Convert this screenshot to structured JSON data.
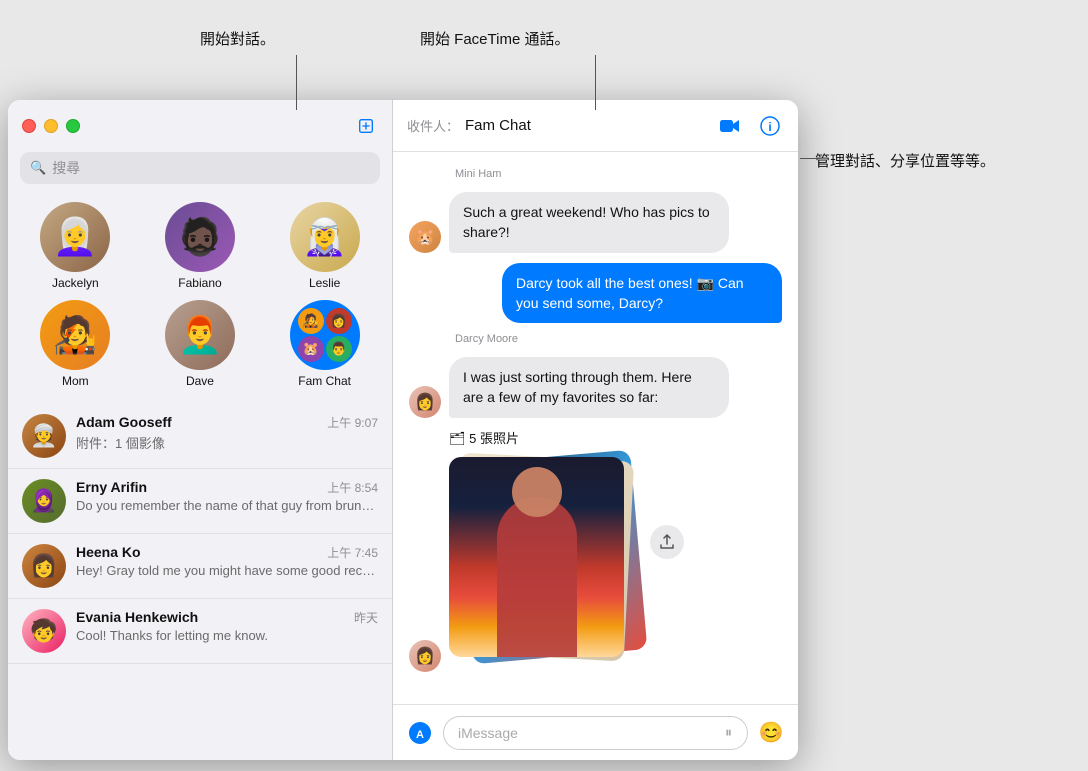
{
  "annotations": {
    "start_chat": "開始對話。",
    "start_facetime": "開始 FaceTime 通話。",
    "manage_chat": "管理對話、分享位置等等。"
  },
  "sidebar": {
    "search_placeholder": "搜尋",
    "compose_icon": "✏",
    "pinned": [
      {
        "id": "jackelyn",
        "name": "Jackelyn",
        "emoji": "👩‍🦳"
      },
      {
        "id": "fabiano",
        "name": "Fabiano",
        "emoji": "🧑‍🦱"
      },
      {
        "id": "leslie",
        "name": "Leslie",
        "emoji": "🧝"
      },
      {
        "id": "mom",
        "name": "Mom",
        "emoji": "🧑‍🎤"
      },
      {
        "id": "dave",
        "name": "Dave",
        "emoji": "👨"
      },
      {
        "id": "famchat",
        "name": "Fam Chat",
        "emoji": "group",
        "selected": true
      }
    ],
    "conversations": [
      {
        "id": "adam",
        "name": "Adam Gooseff",
        "time": "上午 9:07",
        "preview": "附件：1 個影像",
        "emoji": "👳"
      },
      {
        "id": "erny",
        "name": "Erny Arifin",
        "time": "上午 8:54",
        "preview": "Do you remember the name of that guy from brunch?",
        "emoji": "🧕"
      },
      {
        "id": "heena",
        "name": "Heena Ko",
        "time": "上午 7:45",
        "preview": "Hey! Gray told me you might have some good recommendations for our...",
        "emoji": "👩"
      },
      {
        "id": "evania",
        "name": "Evania Henkewich",
        "time": "昨天",
        "preview": "Cool! Thanks for letting me know.",
        "emoji": "🧒"
      }
    ]
  },
  "chat": {
    "to_label": "收件人：",
    "recipient": "Fam Chat",
    "facetime_icon": "📹",
    "info_icon": "ⓘ",
    "messages": [
      {
        "id": "msg1",
        "sender": "Mini Ham",
        "direction": "incoming",
        "text": "Such a great weekend! Who has pics to share?!",
        "avatar_emoji": "🐹"
      },
      {
        "id": "msg2",
        "sender": "me",
        "direction": "outgoing",
        "text": "Darcy took all the best ones! 📷 Can you send some, Darcy?"
      },
      {
        "id": "msg3",
        "sender": "Darcy Moore",
        "direction": "incoming",
        "text": "I was just sorting through them. Here are a few of my favorites so far:",
        "avatar_emoji": "👩"
      },
      {
        "id": "msg4",
        "sender": "Darcy Moore",
        "direction": "incoming",
        "photos_label": "🗂 5 張照片",
        "is_photos": true,
        "avatar_emoji": "👩"
      }
    ],
    "input_placeholder": "iMessage",
    "appstore_icon": "🅐",
    "emoji_icon": "😊"
  }
}
